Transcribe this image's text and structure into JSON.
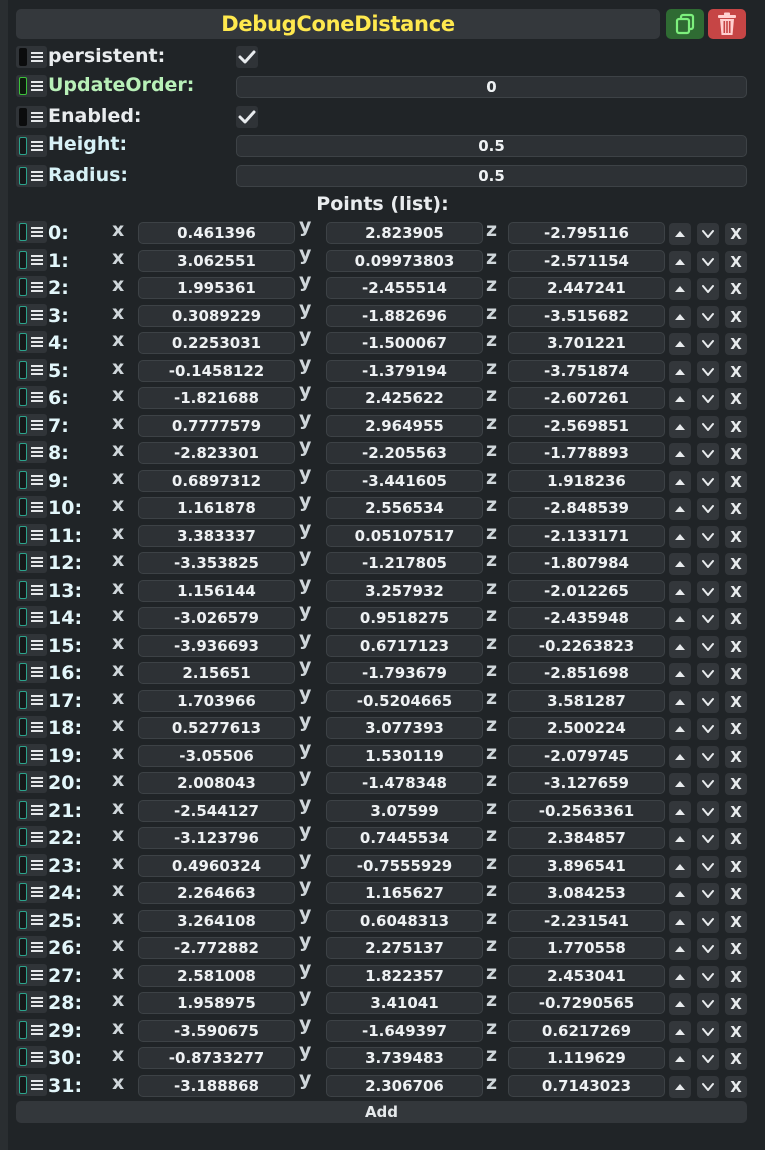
{
  "header": {
    "title": "DebugConeDistance"
  },
  "properties": {
    "persistent": {
      "label": "persistent:",
      "checked": true
    },
    "update_order": {
      "label": "UpdateOrder:",
      "value": "0"
    },
    "enabled": {
      "label": "Enabled:",
      "checked": true
    },
    "height": {
      "label": "Height:",
      "value": "0.5"
    },
    "radius": {
      "label": "Radius:",
      "value": "0.5"
    }
  },
  "points": {
    "title": "Points (list):",
    "axis_labels": {
      "x": "x",
      "y": "y",
      "z": "z"
    },
    "delete_label": "X",
    "add_label": "Add",
    "items": [
      {
        "index": "0:",
        "x": "0.461396",
        "y": "2.823905",
        "z": "-2.795116"
      },
      {
        "index": "1:",
        "x": "3.062551",
        "y": "0.09973803",
        "z": "-2.571154"
      },
      {
        "index": "2:",
        "x": "1.995361",
        "y": "-2.455514",
        "z": "2.447241"
      },
      {
        "index": "3:",
        "x": "0.3089229",
        "y": "-1.882696",
        "z": "-3.515682"
      },
      {
        "index": "4:",
        "x": "0.2253031",
        "y": "-1.500067",
        "z": "3.701221"
      },
      {
        "index": "5:",
        "x": "-0.1458122",
        "y": "-1.379194",
        "z": "-3.751874"
      },
      {
        "index": "6:",
        "x": "-1.821688",
        "y": "2.425622",
        "z": "-2.607261"
      },
      {
        "index": "7:",
        "x": "0.7777579",
        "y": "2.964955",
        "z": "-2.569851"
      },
      {
        "index": "8:",
        "x": "-2.823301",
        "y": "-2.205563",
        "z": "-1.778893"
      },
      {
        "index": "9:",
        "x": "0.6897312",
        "y": "-3.441605",
        "z": "1.918236"
      },
      {
        "index": "10:",
        "x": "1.161878",
        "y": "2.556534",
        "z": "-2.848539"
      },
      {
        "index": "11:",
        "x": "3.383337",
        "y": "0.05107517",
        "z": "-2.133171"
      },
      {
        "index": "12:",
        "x": "-3.353825",
        "y": "-1.217805",
        "z": "-1.807984"
      },
      {
        "index": "13:",
        "x": "1.156144",
        "y": "3.257932",
        "z": "-2.012265"
      },
      {
        "index": "14:",
        "x": "-3.026579",
        "y": "0.9518275",
        "z": "-2.435948"
      },
      {
        "index": "15:",
        "x": "-3.936693",
        "y": "0.6717123",
        "z": "-0.2263823"
      },
      {
        "index": "16:",
        "x": "2.15651",
        "y": "-1.793679",
        "z": "-2.851698"
      },
      {
        "index": "17:",
        "x": "1.703966",
        "y": "-0.5204665",
        "z": "3.581287"
      },
      {
        "index": "18:",
        "x": "0.5277613",
        "y": "3.077393",
        "z": "2.500224"
      },
      {
        "index": "19:",
        "x": "-3.05506",
        "y": "1.530119",
        "z": "-2.079745"
      },
      {
        "index": "20:",
        "x": "2.008043",
        "y": "-1.478348",
        "z": "-3.127659"
      },
      {
        "index": "21:",
        "x": "-2.544127",
        "y": "3.07599",
        "z": "-0.2563361"
      },
      {
        "index": "22:",
        "x": "-3.123796",
        "y": "0.7445534",
        "z": "2.384857"
      },
      {
        "index": "23:",
        "x": "0.4960324",
        "y": "-0.7555929",
        "z": "3.896541"
      },
      {
        "index": "24:",
        "x": "2.264663",
        "y": "1.165627",
        "z": "3.084253"
      },
      {
        "index": "25:",
        "x": "3.264108",
        "y": "0.6048313",
        "z": "-2.231541"
      },
      {
        "index": "26:",
        "x": "-2.772882",
        "y": "2.275137",
        "z": "1.770558"
      },
      {
        "index": "27:",
        "x": "2.581008",
        "y": "1.822357",
        "z": "2.453041"
      },
      {
        "index": "28:",
        "x": "1.958975",
        "y": "3.41041",
        "z": "-0.7290565"
      },
      {
        "index": "29:",
        "x": "-3.590675",
        "y": "-1.649397",
        "z": "0.6217269"
      },
      {
        "index": "30:",
        "x": "-0.8733277",
        "y": "3.739483",
        "z": "1.119629"
      },
      {
        "index": "31:",
        "x": "-3.188868",
        "y": "2.306706",
        "z": "0.7143023"
      }
    ]
  },
  "colors": {
    "title": "#ffe94e",
    "copy_button": "#2f6b33",
    "delete_button": "#c64545",
    "handle_cyan": "#2ca38c",
    "handle_green": "#3cc23c"
  },
  "icons": {
    "copy": "copy-icon",
    "delete": "trash-icon",
    "handle": "drag-handle-icon",
    "check": "checkmark-icon",
    "move_up": "chevron-up-icon",
    "move_down": "chevron-down-icon"
  }
}
